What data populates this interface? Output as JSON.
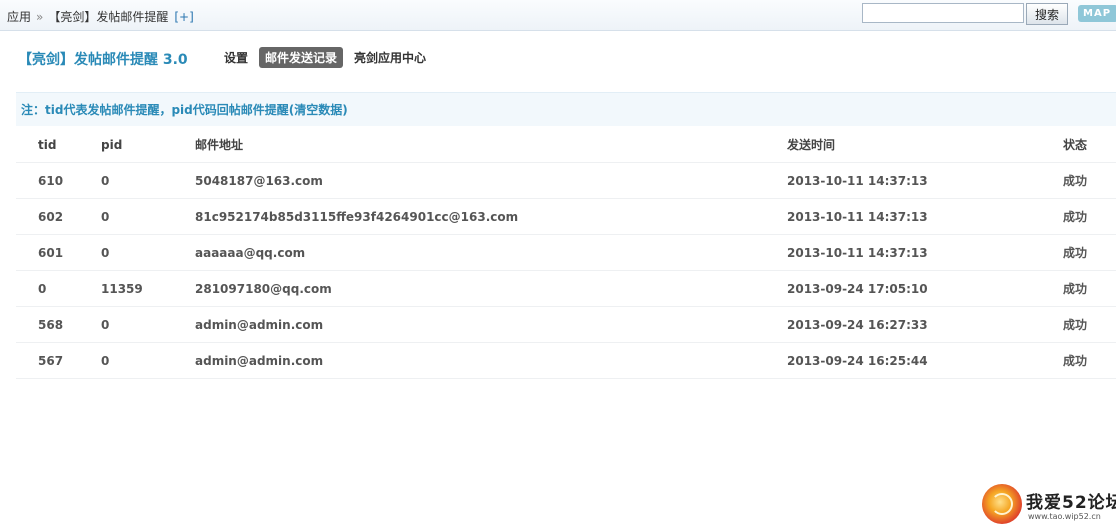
{
  "breadcrumb": {
    "root": "应用",
    "separator": "»",
    "current": "【亮剑】发帖邮件提醒",
    "add_label": "[+]"
  },
  "search": {
    "value": "",
    "placeholder": "",
    "button_label": "搜索"
  },
  "map_button": {
    "label": "MAP"
  },
  "plugin_title": "【亮剑】发帖邮件提醒 3.0",
  "nav": {
    "items": [
      {
        "label": "设置",
        "active": false
      },
      {
        "label": "邮件发送记录",
        "active": true
      },
      {
        "label": "亮剑应用中心",
        "active": false
      }
    ]
  },
  "notice": "注：tid代表发帖邮件提醒，pid代码回帖邮件提醒(清空数据)",
  "table": {
    "headers": {
      "tid": "tid",
      "pid": "pid",
      "email": "邮件地址",
      "time": "发送时间",
      "status": "状态"
    },
    "rows": [
      {
        "tid": "610",
        "pid": "0",
        "email": "5048187@163.com",
        "time": "2013-10-11 14:37:13",
        "status": "成功"
      },
      {
        "tid": "602",
        "pid": "0",
        "email": "81c952174b85d3115ffe93f4264901cc@163.com",
        "time": "2013-10-11 14:37:13",
        "status": "成功"
      },
      {
        "tid": "601",
        "pid": "0",
        "email": "aaaaaa@qq.com",
        "time": "2013-10-11 14:37:13",
        "status": "成功"
      },
      {
        "tid": "0",
        "pid": "11359",
        "email": "281097180@qq.com",
        "time": "2013-09-24 17:05:10",
        "status": "成功"
      },
      {
        "tid": "568",
        "pid": "0",
        "email": "admin@admin.com",
        "time": "2013-09-24 16:27:33",
        "status": "成功"
      },
      {
        "tid": "567",
        "pid": "0",
        "email": "admin@admin.com",
        "time": "2013-09-24 16:25:44",
        "status": "成功"
      }
    ]
  },
  "watermark": {
    "name": "我爱52论坛",
    "url": "www.tao.wip52.cn"
  },
  "colors": {
    "accent": "#2a8ab7",
    "active_tab_bg": "#666666",
    "notice_bg": "#f2f8fc"
  }
}
